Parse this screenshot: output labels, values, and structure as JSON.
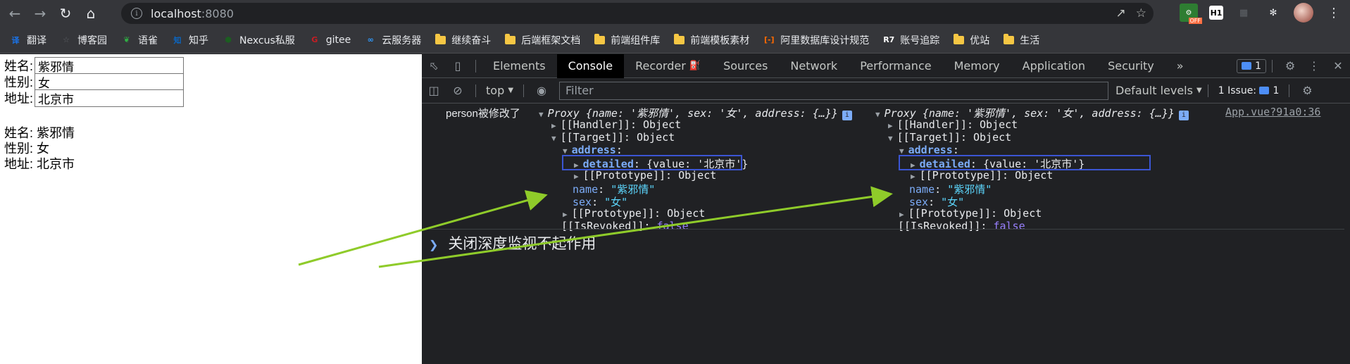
{
  "browser": {
    "url_host": "localhost",
    "url_port": ":8080",
    "extension_off_label": "OFF",
    "extension_h1_label": "H1"
  },
  "bookmarks": [
    {
      "label": "翻译",
      "icon": "translate-icon",
      "color": "#1a73e8",
      "glyph": "译"
    },
    {
      "label": "博客园",
      "icon": "cnblogs-icon",
      "color": "#5f6368",
      "glyph": "☆"
    },
    {
      "label": "语雀",
      "icon": "yuque-icon",
      "color": "#2fb344",
      "glyph": "❦"
    },
    {
      "label": "知乎",
      "icon": "zhihu-icon",
      "color": "#0a66c2",
      "glyph": "知"
    },
    {
      "label": "Nexcus私服",
      "icon": "nexus-icon",
      "color": "#1b5e20",
      "glyph": "⬢"
    },
    {
      "label": "gitee",
      "icon": "gitee-icon",
      "color": "#c71d23",
      "glyph": "G"
    },
    {
      "label": "云服务器",
      "icon": "cloud-icon",
      "color": "#2f9bff",
      "glyph": "∞"
    },
    {
      "label": "继续奋斗",
      "icon": "folder-icon",
      "folder": true
    },
    {
      "label": "后端框架文档",
      "icon": "folder-icon",
      "folder": true
    },
    {
      "label": "前端组件库",
      "icon": "folder-icon",
      "folder": true
    },
    {
      "label": "前端模板素材",
      "icon": "folder-icon",
      "folder": true
    },
    {
      "label": "阿里数据库设计规范",
      "icon": "aliyun-icon",
      "color": "#ff6a00",
      "glyph": "[-]"
    },
    {
      "label": "账号追踪",
      "icon": "r7-icon",
      "color": "#ffffff",
      "glyph": "R7"
    },
    {
      "label": "优站",
      "icon": "folder-icon",
      "folder": true
    },
    {
      "label": "生活",
      "icon": "folder-icon",
      "folder": true
    }
  ],
  "page": {
    "form": [
      {
        "label": "姓名:",
        "value": "紫邪情"
      },
      {
        "label": "性别:",
        "value": "女"
      },
      {
        "label": "地址:",
        "value": "北京市"
      }
    ],
    "output": [
      {
        "label": "姓名:",
        "value": "紫邪情"
      },
      {
        "label": "性别:",
        "value": "女"
      },
      {
        "label": "地址:",
        "value": "北京市"
      }
    ]
  },
  "devtools": {
    "tabs": [
      "Elements",
      "Console",
      "Recorder",
      "Sources",
      "Network",
      "Performance",
      "Memory",
      "Application",
      "Security"
    ],
    "active_tab": "Console",
    "more_tabs": "»",
    "messages_count": "1",
    "context": "top",
    "filter_placeholder": "Filter",
    "levels": "Default levels",
    "issues_label": "1 Issue:",
    "issues_count": "1",
    "log": {
      "prefix": "person被修改了",
      "source": "App.vue?91a0:36",
      "summary_head": "Proxy",
      "summary_body": "{name: '紫邪情', sex: '女', address: {…}}",
      "handler": "[[Handler]]: Object",
      "target": "[[Target]]: Object",
      "address_key": "address",
      "detailed_key": "detailed",
      "detailed_val": "{value: '北京市'}",
      "prototype": "[[Prototype]]: Object",
      "name_key": "name",
      "name_val": "\"紫邪情\"",
      "sex_key": "sex",
      "sex_val_left": "\"女\"",
      "sex_val_right": "\"女\"",
      "revoked_key": "[[IsRevoked]]",
      "revoked_val": "false"
    },
    "prompt_text": "关闭深度监视不起作用"
  }
}
